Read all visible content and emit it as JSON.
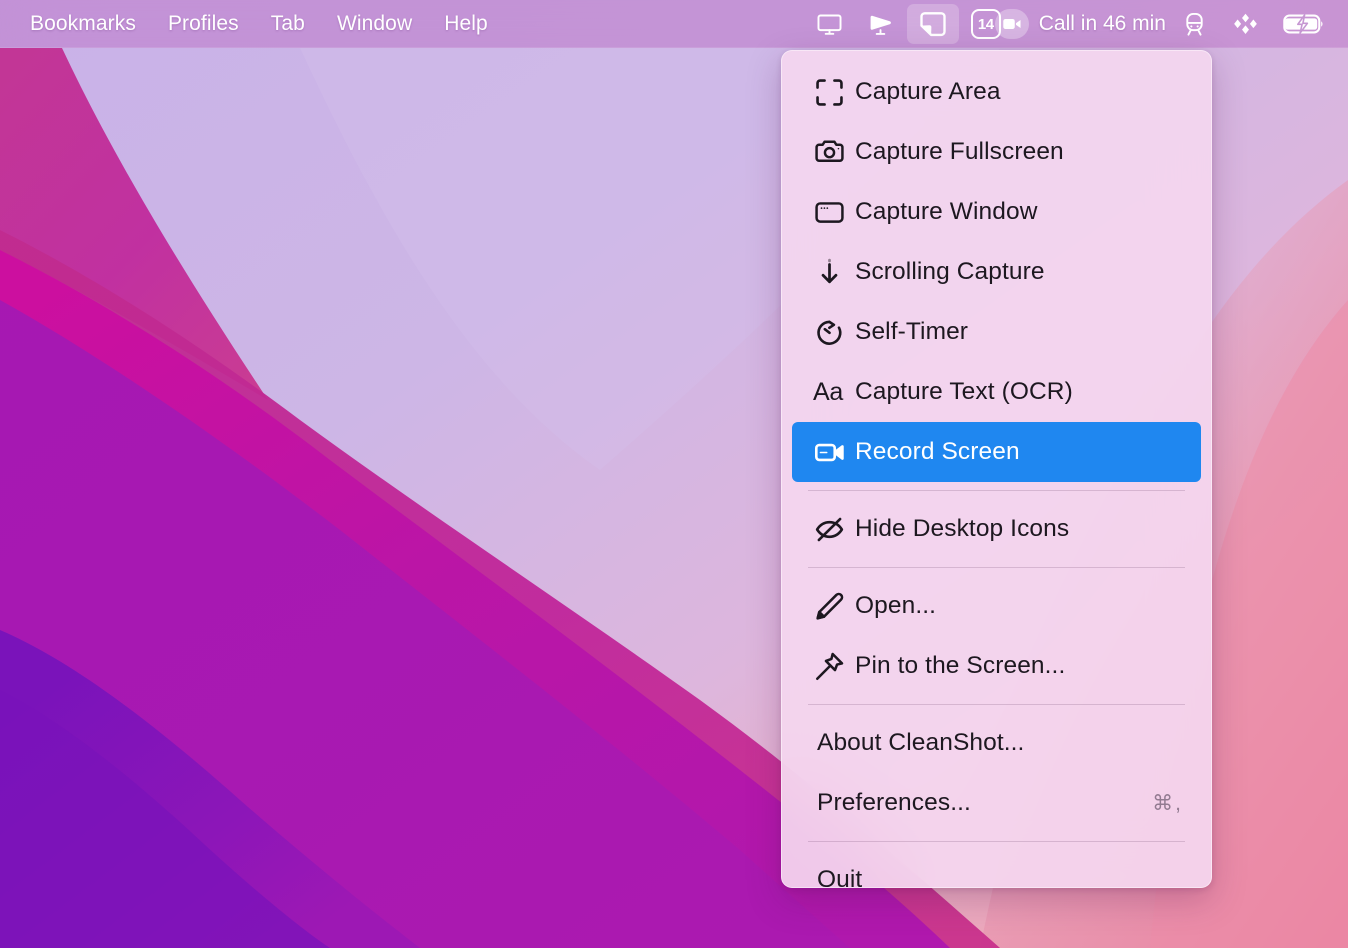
{
  "menubar": {
    "items": [
      {
        "label": "Bookmarks",
        "name": "menubar-item-bookmarks"
      },
      {
        "label": "Profiles",
        "name": "menubar-item-profiles"
      },
      {
        "label": "Tab",
        "name": "menubar-item-tab"
      },
      {
        "label": "Window",
        "name": "menubar-item-window"
      },
      {
        "label": "Help",
        "name": "menubar-item-help"
      }
    ],
    "status": {
      "display_icon": "display-icon",
      "screen_tilt_icon": "screen-mirroring-icon",
      "cleanshot_icon": "cleanshot-icon",
      "calendar_badge": "14",
      "video_icon": "video-call-icon",
      "call_text": "Call in 46 min",
      "transit_icon": "transit-train-icon",
      "dropbox_icon": "dropbox-diamond-icon",
      "battery_icon": "battery-charging-icon"
    }
  },
  "menu": {
    "items": [
      {
        "label": "Capture Area",
        "icon": "crop-marks-icon",
        "type": "icon",
        "selected": false
      },
      {
        "label": "Capture Fullscreen",
        "icon": "camera-icon",
        "type": "icon",
        "selected": false
      },
      {
        "label": "Capture Window",
        "icon": "window-icon",
        "type": "icon",
        "selected": false
      },
      {
        "label": "Scrolling Capture",
        "icon": "arrow-down-icon",
        "type": "icon",
        "selected": false
      },
      {
        "label": "Self-Timer",
        "icon": "timer-icon",
        "type": "icon",
        "selected": false
      },
      {
        "label": "Capture Text (OCR)",
        "icon": "aa-text-icon",
        "type": "icon",
        "selected": false
      },
      {
        "label": "Record Screen",
        "icon": "video-camera-icon",
        "type": "icon",
        "selected": true
      },
      {
        "label": "Hide Desktop Icons",
        "icon": "eye-slash-icon",
        "type": "icon",
        "selected": false
      },
      {
        "label": "Open...",
        "icon": "pencil-icon",
        "type": "icon",
        "selected": false
      },
      {
        "label": "Pin to the Screen...",
        "icon": "pushpin-icon",
        "type": "icon",
        "selected": false
      },
      {
        "label": "About CleanShot...",
        "icon": "",
        "type": "plain",
        "selected": false
      },
      {
        "label": "Preferences...",
        "icon": "",
        "type": "plain",
        "selected": false,
        "shortcut": "⌘,"
      },
      {
        "label": "Quit",
        "icon": "",
        "type": "plain",
        "selected": false
      }
    ],
    "selected_color": "#1f87f0",
    "background_color": "#f4d6ef"
  },
  "wallpaper": {
    "name": "macos-monterey-purple-waves",
    "colors": [
      "#cbb4e6",
      "#e8c3dd",
      "#c8299f",
      "#a21bb5",
      "#7013b6",
      "#e78aa6"
    ]
  }
}
